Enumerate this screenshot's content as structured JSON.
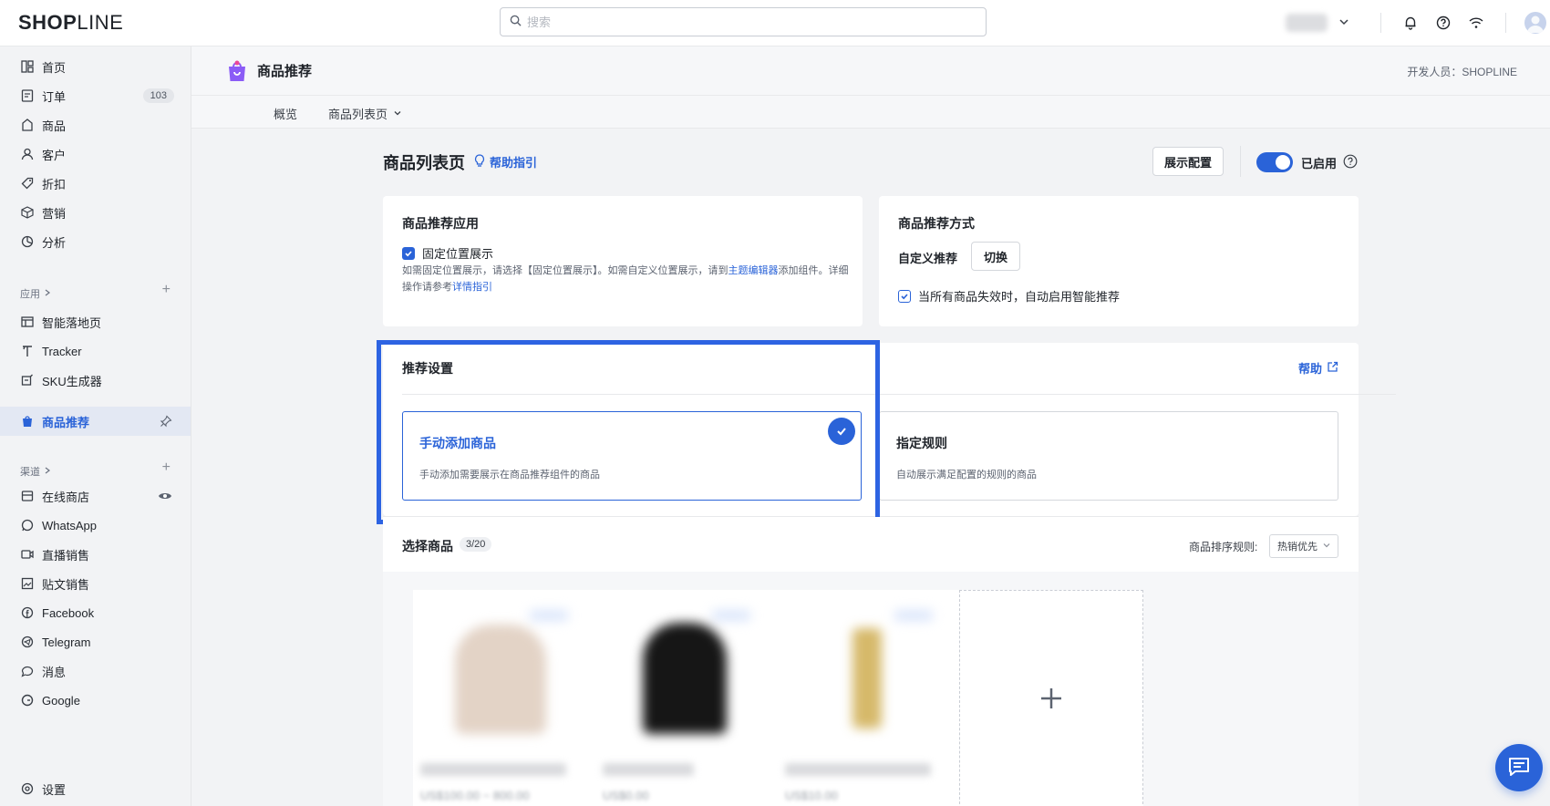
{
  "topbar": {
    "logo_bold": "SHOP",
    "logo_light": "LINE",
    "search_placeholder": "搜索"
  },
  "sidebar": {
    "items": [
      {
        "label": "首页",
        "icon": "dashboard-icon"
      },
      {
        "label": "订单",
        "icon": "order-icon",
        "badge": "103"
      },
      {
        "label": "商品",
        "icon": "bag-icon"
      },
      {
        "label": "客户",
        "icon": "user-icon"
      },
      {
        "label": "折扣",
        "icon": "tag-icon"
      },
      {
        "label": "营销",
        "icon": "cube-icon"
      },
      {
        "label": "分析",
        "icon": "chart-icon"
      }
    ],
    "apps_label": "应用",
    "apps": [
      {
        "label": "智能落地页",
        "icon": "layout-icon"
      },
      {
        "label": "Tracker",
        "icon": "tracker-icon"
      },
      {
        "label": "SKU生成器",
        "icon": "sku-icon"
      }
    ],
    "active_item": "商品推荐",
    "channels_label": "渠道",
    "channels": [
      {
        "label": "在线商店",
        "icon": "store-icon"
      },
      {
        "label": "WhatsApp",
        "icon": "whatsapp-icon"
      },
      {
        "label": "直播销售",
        "icon": "video-icon"
      },
      {
        "label": "贴文销售",
        "icon": "post-icon"
      },
      {
        "label": "Facebook",
        "icon": "facebook-icon"
      },
      {
        "label": "Telegram",
        "icon": "telegram-icon"
      },
      {
        "label": "消息",
        "icon": "message-icon"
      },
      {
        "label": "Google",
        "icon": "google-icon"
      }
    ],
    "settings": "设置"
  },
  "header": {
    "app_title": "商品推荐",
    "developer": "开发人员：SHOPLINE"
  },
  "subnav": {
    "overview": "概览",
    "product_list": "商品列表页"
  },
  "main": {
    "page_title": "商品列表页",
    "help_guide": "帮助指引",
    "display_config": "展示配置",
    "enabled": "已启用",
    "app_card": {
      "title": "商品推荐应用",
      "checkbox": "固定位置展示",
      "desc_1": "如需固定位置展示，请选择【固定位置展示】。如需自定义位置展示，请到",
      "desc_link_1": "主题编辑器",
      "desc_2": "添加组件。详细",
      "desc_3": "操作请参考",
      "desc_link_2": "详情指引"
    },
    "method_card": {
      "title": "商品推荐方式",
      "custom": "自定义推荐",
      "switch": "切换",
      "fallback": "当所有商品失效时，自动启用智能推荐"
    },
    "settings_card": {
      "title": "推荐设置",
      "help": "帮助",
      "manual_title": "手动添加商品",
      "manual_desc": "手动添加需要展示在商品推荐组件的商品",
      "rule_title": "指定规则",
      "rule_desc": "自动展示满足配置的规则的商品"
    },
    "select_products": {
      "title": "选择商品",
      "count": "3/20",
      "sort_label": "商品排序规则:",
      "sort_value": "热销优先",
      "prices": [
        "US$100.00 ~ 800.00",
        "US$0.00",
        "US$10.00"
      ]
    }
  }
}
